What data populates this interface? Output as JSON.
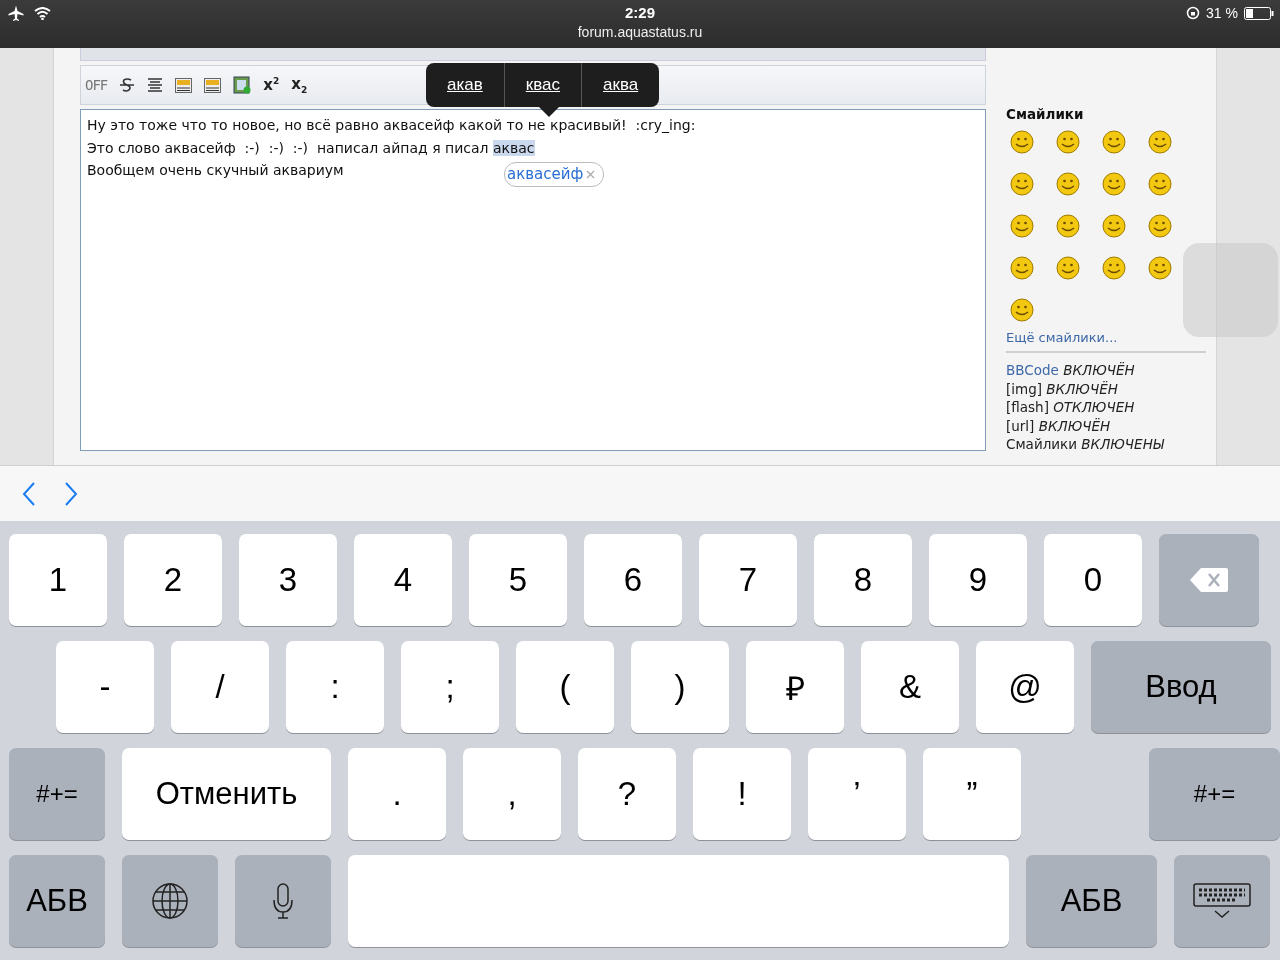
{
  "status_bar": {
    "time": "2:29",
    "url": "forum.aquastatus.ru",
    "battery_text": "31 %"
  },
  "editor": {
    "toolbar": [
      {
        "kind": "label",
        "text": "OFF"
      },
      {
        "kind": "strike"
      },
      {
        "kind": "align"
      },
      {
        "kind": "picture"
      },
      {
        "kind": "picture"
      },
      {
        "kind": "film"
      },
      {
        "kind": "superscript",
        "text": "x",
        "index": "2"
      },
      {
        "kind": "subscript",
        "text": "x",
        "index": "2"
      }
    ],
    "lines": [
      {
        "text": "Ну это тоже что то новое, но всё равно аквасейф какой то не красивый!  :cry_ing:"
      },
      {
        "text": "Это слово аквасейф  :-)  :-)  :-)  написал айпад я писал ",
        "selected_text": "аквас"
      },
      {
        "text": "Вообщем очень скучный аквариум"
      }
    ],
    "autocorrect": "аквасейф",
    "suggestions": [
      "акав",
      "квас",
      "аква"
    ]
  },
  "sidebar": {
    "title": "Смайлики",
    "more_link": "Ещё смайлики...",
    "settings": [
      {
        "label": "BBCode",
        "link": true,
        "status": "ВКЛЮЧЁН"
      },
      {
        "label": "[img]",
        "link": false,
        "status": "ВКЛЮЧЁН"
      },
      {
        "label": "[flash]",
        "link": false,
        "status": "ОТКЛЮЧЕН"
      },
      {
        "label": "[url]",
        "link": false,
        "status": "ВКЛЮЧЁН"
      },
      {
        "label": "Смайлики",
        "link": false,
        "status": "ВКЛЮЧЕНЫ"
      }
    ]
  },
  "keyboard": {
    "rows": [
      [
        {
          "kind": "char",
          "text": "1"
        },
        {
          "kind": "char",
          "text": "2"
        },
        {
          "kind": "char",
          "text": "3"
        },
        {
          "kind": "char",
          "text": "4"
        },
        {
          "kind": "char",
          "text": "5"
        },
        {
          "kind": "char",
          "text": "6"
        },
        {
          "kind": "char",
          "text": "7"
        },
        {
          "kind": "char",
          "text": "8"
        },
        {
          "kind": "char",
          "text": "9"
        },
        {
          "kind": "char",
          "text": "0"
        },
        {
          "kind": "backspace"
        }
      ],
      [
        {
          "kind": "char",
          "text": "-"
        },
        {
          "kind": "char",
          "text": "/"
        },
        {
          "kind": "char",
          "text": ":"
        },
        {
          "kind": "char",
          "text": ";"
        },
        {
          "kind": "char",
          "text": "("
        },
        {
          "kind": "char",
          "text": ")"
        },
        {
          "kind": "char",
          "text": "₽"
        },
        {
          "kind": "char",
          "text": "&"
        },
        {
          "kind": "char",
          "text": "@"
        },
        {
          "kind": "return",
          "text": "Ввод"
        }
      ],
      [
        {
          "kind": "shift",
          "text": "#+="
        },
        {
          "kind": "wide",
          "text": "Отменить"
        },
        {
          "kind": "char",
          "text": "."
        },
        {
          "kind": "char",
          "text": ","
        },
        {
          "kind": "char",
          "text": "?"
        },
        {
          "kind": "char",
          "text": "!"
        },
        {
          "kind": "char",
          "text": "’"
        },
        {
          "kind": "char",
          "text": "”"
        },
        {
          "kind": "gap"
        },
        {
          "kind": "shift",
          "text": "#+="
        }
      ],
      [
        {
          "kind": "mode",
          "text": "АБВ"
        },
        {
          "kind": "globe"
        },
        {
          "kind": "mic"
        },
        {
          "kind": "space"
        },
        {
          "kind": "mode_wide",
          "text": "АБВ"
        },
        {
          "kind": "hide"
        }
      ]
    ]
  }
}
